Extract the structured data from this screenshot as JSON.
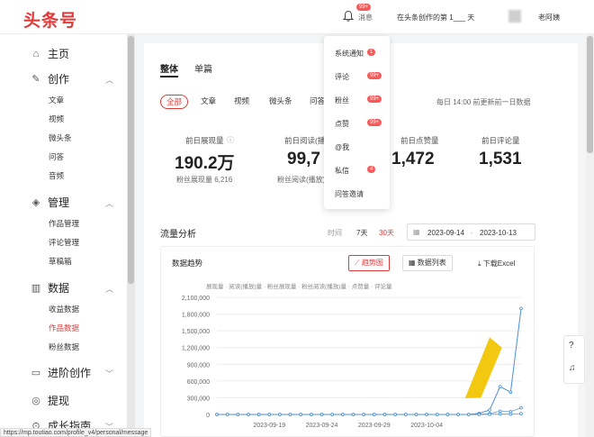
{
  "header": {
    "logo": "头条号",
    "messages_label": "消息",
    "messages_badge": "99+",
    "creator_text": "在头条创作的第 1___ 天",
    "username": "老阿姨"
  },
  "sidebar": {
    "items": [
      {
        "label": "主页",
        "icon": "home-icon"
      },
      {
        "label": "创作",
        "icon": "edit-icon",
        "children": [
          "文章",
          "视频",
          "微头条",
          "问答",
          "音频"
        ]
      },
      {
        "label": "管理",
        "icon": "layers-icon",
        "children": [
          "作品管理",
          "评论管理",
          "草稿箱"
        ]
      },
      {
        "label": "数据",
        "icon": "bar-chart-icon",
        "children": [
          "收益数据",
          "作品数据",
          "粉丝数据"
        ]
      },
      {
        "label": "进阶创作",
        "icon": "folder-icon"
      },
      {
        "label": "提现",
        "icon": "coin-icon"
      },
      {
        "label": "成长指南",
        "icon": "compass-icon"
      }
    ],
    "active_sub": "作品数据"
  },
  "main": {
    "tabs": [
      "整体",
      "单篇"
    ],
    "filters": [
      "全部",
      "文章",
      "视频",
      "微头条",
      "问答"
    ],
    "update_note": "每日 14:00 前更新前一日数据",
    "stats": [
      {
        "label": "前日展现量",
        "value": "190.2万",
        "sub": "粉丝展现量 6,216"
      },
      {
        "label": "前日阅读(播放)量",
        "value": "99,7",
        "sub": "粉丝阅读(播放)量"
      },
      {
        "label": "前日点赞量",
        "value": "1,472",
        "sub": ""
      },
      {
        "label": "前日评论量",
        "value": "1,531",
        "sub": ""
      }
    ],
    "flow_title": "流量分析",
    "time_label": "时间",
    "ranges": [
      "7天",
      "30天"
    ],
    "date_start": "2023-09-14",
    "date_end": "2023-10-13",
    "chart_panel": {
      "title": "数据趋势",
      "trend_btn": "趋势图",
      "list_btn": "数据列表",
      "download_btn": "下载Excel",
      "legend": "展现量 · 阅读(播放)量 · 粉丝展现量 · 粉丝阅读(播放)量 · 点赞量 · 评论量"
    }
  },
  "dropdown": {
    "items": [
      {
        "label": "系统通知",
        "badge": "1"
      },
      {
        "label": "评论",
        "badge": "99+"
      },
      {
        "label": "粉丝",
        "badge": "99+"
      },
      {
        "label": "点赞",
        "badge": "99+"
      },
      {
        "label": "@我",
        "badge": ""
      },
      {
        "label": "私信",
        "badge": "4"
      },
      {
        "label": "问答邀请",
        "badge": ""
      }
    ]
  },
  "statusbar": {
    "url": "https://mp.toutiao.com/profile_v4/personal/message"
  },
  "chart_data": {
    "type": "line",
    "x": [
      "2023-09-14",
      "2023-09-15",
      "2023-09-16",
      "2023-09-17",
      "2023-09-18",
      "2023-09-19",
      "2023-09-20",
      "2023-09-21",
      "2023-09-22",
      "2023-09-23",
      "2023-09-24",
      "2023-09-25",
      "2023-09-26",
      "2023-09-27",
      "2023-09-28",
      "2023-09-29",
      "2023-09-30",
      "2023-10-01",
      "2023-10-02",
      "2023-10-03",
      "2023-10-04",
      "2023-10-05",
      "2023-10-06",
      "2023-10-07",
      "2023-10-08",
      "2023-10-09",
      "2023-10-10",
      "2023-10-11",
      "2023-10-12",
      "2023-10-13"
    ],
    "x_tick_labels": [
      "2023-09-19",
      "2023-09-24",
      "2023-09-29",
      "2023-10-04"
    ],
    "y_ticks": [
      "2,100,000",
      "1,800,000",
      "1,500,000",
      "1,200,000",
      "900,000",
      "600,000",
      "300,000",
      "0"
    ],
    "ylim": [
      0,
      2100000
    ],
    "series": [
      {
        "name": "展现量",
        "values": [
          0,
          0,
          0,
          0,
          0,
          0,
          0,
          0,
          0,
          0,
          0,
          0,
          0,
          0,
          0,
          0,
          0,
          0,
          0,
          0,
          0,
          0,
          0,
          0,
          0,
          20000,
          80000,
          500000,
          400000,
          1900000
        ]
      },
      {
        "name": "阅读(播放)量",
        "values": [
          0,
          0,
          0,
          0,
          0,
          0,
          0,
          0,
          0,
          0,
          0,
          0,
          0,
          0,
          0,
          0,
          0,
          0,
          0,
          0,
          0,
          0,
          0,
          0,
          0,
          5000,
          15000,
          60000,
          50000,
          120000
        ]
      },
      {
        "name": "粉丝展现量",
        "values": [
          0,
          0,
          0,
          0,
          0,
          0,
          0,
          0,
          0,
          0,
          0,
          0,
          0,
          0,
          0,
          0,
          0,
          0,
          0,
          0,
          0,
          0,
          0,
          0,
          0,
          1000,
          3000,
          8000,
          6000,
          15000
        ]
      }
    ],
    "grid": true,
    "colors": {
      "main": "#4a8fd4",
      "accent": "#e03a3a",
      "arrow": "#f2c811"
    }
  }
}
